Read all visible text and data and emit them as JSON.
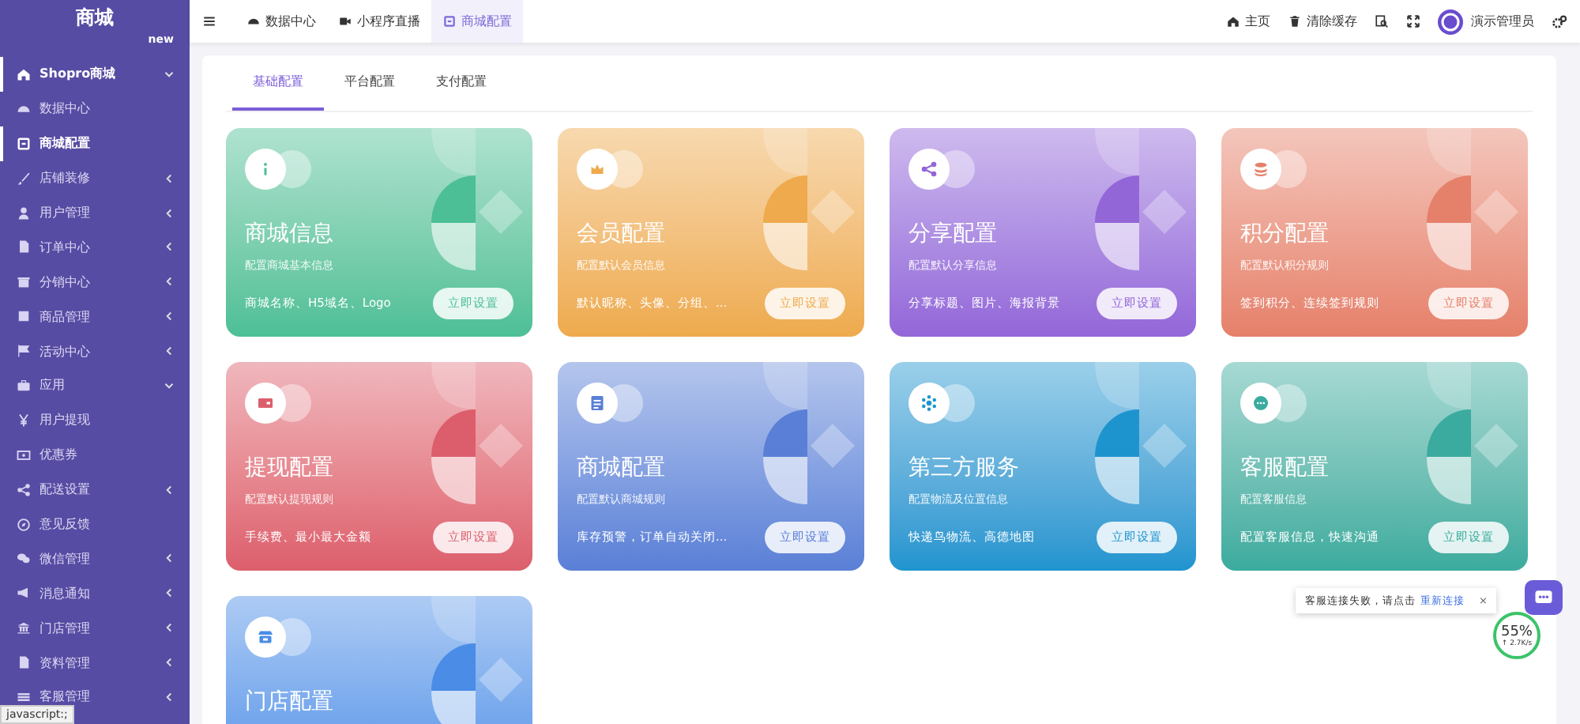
{
  "sidebar": {
    "logo": "商城",
    "cut_item_badge": "new",
    "items": [
      {
        "kind": "group",
        "label": "Shopro商城",
        "selected": true,
        "expanded": true
      },
      {
        "kind": "link",
        "label": "数据中心",
        "selected": false
      },
      {
        "kind": "link",
        "label": "商城配置",
        "selected": true
      },
      {
        "kind": "group",
        "label": "店铺装修",
        "selected": false,
        "expanded": false
      },
      {
        "kind": "group",
        "label": "用户管理",
        "selected": false,
        "expanded": false
      },
      {
        "kind": "group",
        "label": "订单中心",
        "selected": false,
        "expanded": false
      },
      {
        "kind": "group",
        "label": "分销中心",
        "selected": false,
        "expanded": false
      },
      {
        "kind": "group",
        "label": "商品管理",
        "selected": false,
        "expanded": false
      },
      {
        "kind": "group",
        "label": "活动中心",
        "selected": false,
        "expanded": false
      },
      {
        "kind": "group",
        "label": "应用",
        "selected": false,
        "expanded": true
      },
      {
        "kind": "link",
        "label": "用户提现",
        "selected": false
      },
      {
        "kind": "link",
        "label": "优惠券",
        "selected": false
      },
      {
        "kind": "group",
        "label": "配送设置",
        "selected": false,
        "expanded": false
      },
      {
        "kind": "link",
        "label": "意见反馈",
        "selected": false
      },
      {
        "kind": "group",
        "label": "微信管理",
        "selected": false,
        "expanded": false
      },
      {
        "kind": "group",
        "label": "消息通知",
        "selected": false,
        "expanded": false
      },
      {
        "kind": "group",
        "label": "门店管理",
        "selected": false,
        "expanded": false
      },
      {
        "kind": "group",
        "label": "资料管理",
        "selected": false,
        "expanded": false
      },
      {
        "kind": "group",
        "label": "客服管理",
        "selected": false,
        "expanded": false
      }
    ]
  },
  "topbar": {
    "tabs": [
      {
        "label": "数据中心",
        "selected": false
      },
      {
        "label": "小程序直播",
        "selected": false
      },
      {
        "label": "商城配置",
        "selected": true
      }
    ],
    "actions": [
      {
        "label": "主页"
      },
      {
        "label": "清除缓存"
      }
    ],
    "user": "演示管理员"
  },
  "config_tabs": [
    {
      "label": "基础配置",
      "selected": true
    },
    {
      "label": "平台配置",
      "selected": false
    },
    {
      "label": "支付配置",
      "selected": false
    }
  ],
  "cards": [
    {
      "title": "商城信息",
      "desc": "配置商城基本信息",
      "features": "商城名称、H5域名、Logo",
      "button": "立即设置",
      "color": "#4cbf96"
    },
    {
      "title": "会员配置",
      "desc": "配置默认会员信息",
      "features": "默认昵称、头像、分组、...",
      "button": "立即设置",
      "color": "#eeaa4c"
    },
    {
      "title": "分享配置",
      "desc": "配置默认分享信息",
      "features": "分享标题、图片、海报背景",
      "button": "立即设置",
      "color": "#9366d8"
    },
    {
      "title": "积分配置",
      "desc": "配置默认积分规则",
      "features": "签到积分、连续签到规则",
      "button": "立即设置",
      "color": "#e5806a"
    },
    {
      "title": "提现配置",
      "desc": "配置默认提现规则",
      "features": "手续费、最小最大金额",
      "button": "立即设置",
      "color": "#dc5e6c"
    },
    {
      "title": "商城配置",
      "desc": "配置默认商城规则",
      "features": "库存预警，订单自动关闭...",
      "button": "立即设置",
      "color": "#5a7fd6"
    },
    {
      "title": "第三方服务",
      "desc": "配置物流及位置信息",
      "features": "快递鸟物流、高德地图",
      "button": "立即设置",
      "color": "#1e94cf"
    },
    {
      "title": "客服配置",
      "desc": "配置客服信息",
      "features": "配置客服信息，快速沟通",
      "button": "立即设置",
      "color": "#3aab9e"
    },
    {
      "title": "门店配置",
      "color": "#4a8ce6"
    }
  ],
  "toast": {
    "message": "客服连接失败，请点击",
    "link": "重新连接",
    "close": "×"
  },
  "speed_meter": {
    "percent": "55%",
    "rate": "↑ 2.7K/s"
  },
  "status_url": "javascript:;"
}
